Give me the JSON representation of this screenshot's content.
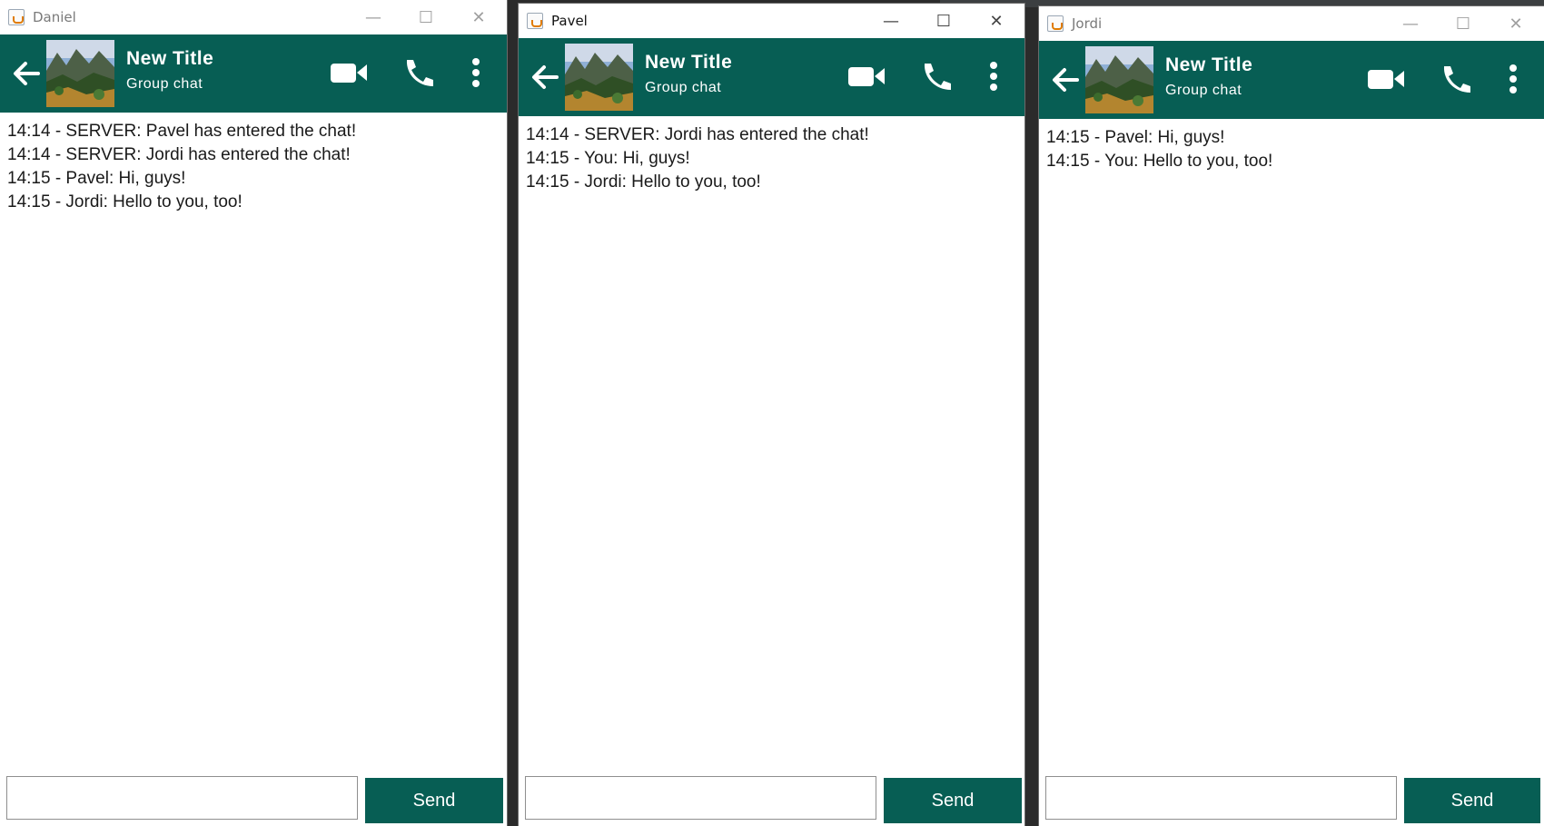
{
  "windows": [
    {
      "title": "Daniel",
      "header": {
        "title": "New Title",
        "subtitle": "Group chat"
      },
      "messages": [
        "14:14 - SERVER: Pavel has entered the chat!",
        "14:14 - SERVER: Jordi has entered the chat!",
        "14:15 - Pavel: Hi, guys!",
        "14:15 - Jordi: Hello to you, too!"
      ],
      "input_value": "",
      "send_label": "Send"
    },
    {
      "title": "Pavel",
      "header": {
        "title": "New Title",
        "subtitle": "Group chat"
      },
      "messages": [
        "14:14 - SERVER: Jordi has entered the chat!",
        "14:15 - You: Hi, guys!",
        "14:15 - Jordi: Hello to you, too!"
      ],
      "input_value": "",
      "send_label": "Send"
    },
    {
      "title": "Jordi",
      "header": {
        "title": "New Title",
        "subtitle": "Group chat"
      },
      "messages": [
        "14:15 - Pavel: Hi, guys!",
        "14:15 - You: Hello to you, too!"
      ],
      "input_value": "",
      "send_label": "Send"
    }
  ],
  "colors": {
    "header": "#075e54",
    "send_button": "#075e54"
  },
  "icons": [
    "back-arrow-icon",
    "video-call-icon",
    "phone-icon",
    "more-vertical-icon"
  ]
}
